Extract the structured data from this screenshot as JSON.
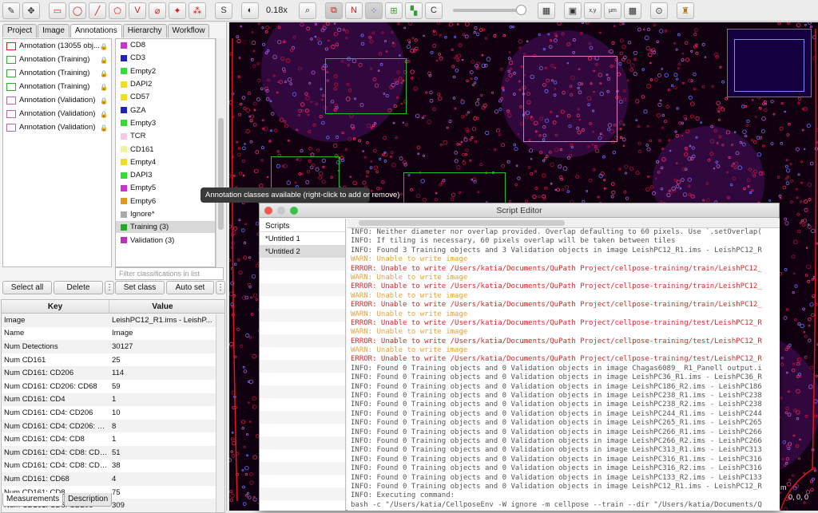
{
  "toolbar": {
    "buttons": [
      {
        "name": "brush-tool-icon",
        "glyph": "✎"
      },
      {
        "name": "move-tool-icon",
        "glyph": "✥"
      },
      {
        "name": "rectangle-tool-icon",
        "glyph": "▭",
        "color": "red"
      },
      {
        "name": "ellipse-tool-icon",
        "glyph": "◯",
        "color": "red"
      },
      {
        "name": "line-tool-icon",
        "glyph": "╱",
        "color": "red"
      },
      {
        "name": "polygon-tool-icon",
        "glyph": "⬠",
        "color": "red"
      },
      {
        "name": "polyline-tool-icon",
        "glyph": "V",
        "color": "red"
      },
      {
        "name": "brush-annotation-icon",
        "glyph": "⌀",
        "color": "red"
      },
      {
        "name": "wand-tool-icon",
        "glyph": "✦",
        "color": "red"
      },
      {
        "name": "points-tool-icon",
        "glyph": "⁂",
        "color": "red"
      }
    ],
    "selection_mode_label": "S",
    "zoom_label": "0.18x",
    "c_label": "C",
    "n_label": "N",
    "xy_label": "x,y",
    "um_label": "µm"
  },
  "left_tabs": [
    "Project",
    "Image",
    "Annotations",
    "Hierarchy",
    "Workflow"
  ],
  "active_left_tab": "Annotations",
  "annotations": [
    {
      "label": "Annotation (13055 obj...",
      "color": "#d02020"
    },
    {
      "label": "Annotation (Training)",
      "color": "#30b030"
    },
    {
      "label": "Annotation (Training)",
      "color": "#30b030"
    },
    {
      "label": "Annotation (Training)",
      "color": "#30b030"
    },
    {
      "label": "Annotation (Validation)",
      "color": "#c060b0"
    },
    {
      "label": "Annotation (Validation)",
      "color": "#c060b0"
    },
    {
      "label": "Annotation (Validation)",
      "color": "#c060b0"
    }
  ],
  "classes": [
    {
      "label": "CD8",
      "color": "#cc33cc"
    },
    {
      "label": "CD3",
      "color": "#1a22b8"
    },
    {
      "label": "Empty2",
      "color": "#33dd33"
    },
    {
      "label": "DAPI2",
      "color": "#eedd22"
    },
    {
      "label": "CD57",
      "color": "#eedd22"
    },
    {
      "label": "GZA",
      "color": "#1a22b8"
    },
    {
      "label": "Empty3",
      "color": "#33dd33"
    },
    {
      "label": "TCR",
      "color": "#f7c8e6"
    },
    {
      "label": "CD161",
      "color": "#eef5a0"
    },
    {
      "label": "Empty4",
      "color": "#eedd22"
    },
    {
      "label": "DAPI3",
      "color": "#33dd33"
    },
    {
      "label": "Empty5",
      "color": "#cc33cc"
    },
    {
      "label": "Empty6",
      "color": "#e09a1a"
    },
    {
      "label": "Ignore*",
      "color": "#aaaaaa"
    },
    {
      "label": "Training (3)",
      "color": "#22aa22",
      "selected": true
    },
    {
      "label": "Validation (3)",
      "color": "#bb33bb"
    }
  ],
  "filter_placeholder": "Filter classifications in list",
  "buttons": {
    "select_all": "Select all",
    "delete": "Delete",
    "more": "⋮",
    "set_class": "Set class",
    "auto_set": "Auto set"
  },
  "measure_table": {
    "headers": [
      "Key",
      "Value"
    ],
    "rows": [
      [
        "Image",
        "LeishPC12_R1.ims - LeishP..."
      ],
      [
        "Name",
        "Image"
      ],
      [
        "Num Detections",
        "30127"
      ],
      [
        "Num CD161",
        "25"
      ],
      [
        "Num CD161: CD206",
        "114"
      ],
      [
        "Num CD161: CD206: CD68",
        "59"
      ],
      [
        "Num CD161: CD4",
        "1"
      ],
      [
        "Num CD161: CD4: CD206",
        "10"
      ],
      [
        "Num CD161: CD4: CD206: C...",
        "8"
      ],
      [
        "Num CD161: CD4: CD8",
        "1"
      ],
      [
        "Num CD161: CD4: CD8: CD2...",
        "51"
      ],
      [
        "Num CD161: CD4: CD8: CD2...",
        "38"
      ],
      [
        "Num CD161: CD68",
        "4"
      ],
      [
        "Num CD161: CD8",
        "75"
      ],
      [
        "Num CD161: CD8: CD206",
        "309"
      ]
    ]
  },
  "bottom_tabs": [
    "Measurements",
    "Description"
  ],
  "tooltip": "Annotation classes available (right-click to add or remove)",
  "viewer": {
    "scale_label": "m",
    "coord_label": "0, 0, 0"
  },
  "editor": {
    "title": "Script Editor",
    "scripts_header": "Scripts",
    "scripts": [
      {
        "label": "*Untitled 1",
        "selected": false
      },
      {
        "label": "*Untitled 2",
        "selected": true
      }
    ],
    "lines": [
      {
        "t": "INFO: Neither diameter nor overlap provided. Overlap defaulting to 60 pixels. Use `.setOverlap(",
        "k": "info"
      },
      {
        "t": "INFO: If tiling is necessary, 60 pixels overlap will be taken between tiles",
        "k": "info"
      },
      {
        "t": "INFO: Found 3 Training objects and 3 Validation objects in image LeishPC12_R1.ims - LeishPC12_R",
        "k": "info"
      },
      {
        "t": "WARN: Unable to write image",
        "k": "warn"
      },
      {
        "t": "ERROR: Unable to write /Users/katia/Documents/QuPath Project/cellpose-training/train/LeishPC12_",
        "k": "err"
      },
      {
        "t": "WARN: Unable to write image",
        "k": "warn"
      },
      {
        "t": "ERROR: Unable to write /Users/katia/Documents/QuPath Project/cellpose-training/train/LeishPC12_",
        "k": "err"
      },
      {
        "t": "WARN: Unable to write image",
        "k": "warn"
      },
      {
        "t": "ERROR: Unable to write /Users/katia/Documents/QuPath Project/cellpose-training/train/LeishPC12_",
        "k": "err"
      },
      {
        "t": "WARN: Unable to write image",
        "k": "warn"
      },
      {
        "t": "ERROR: Unable to write /Users/katia/Documents/QuPath Project/cellpose-training/test/LeishPC12_R",
        "k": "err"
      },
      {
        "t": "WARN: Unable to write image",
        "k": "warn"
      },
      {
        "t": "ERROR: Unable to write /Users/katia/Documents/QuPath Project/cellpose-training/test/LeishPC12_R",
        "k": "err"
      },
      {
        "t": "WARN: Unable to write image",
        "k": "warn"
      },
      {
        "t": "ERROR: Unable to write /Users/katia/Documents/QuPath Project/cellpose-training/test/LeishPC12_R",
        "k": "err"
      },
      {
        "t": "INFO: Found 0 Training objects and 0 Validation objects in image Chagas6089_ R1_Panell output.i",
        "k": "info"
      },
      {
        "t": "INFO: Found 0 Training objects and 0 Validation objects in image LeishPC36_R1.ims - LeishPC36_R",
        "k": "info"
      },
      {
        "t": "INFO: Found 0 Training objects and 0 Validation objects in image LeishPC186_R2.ims - LeishPC186",
        "k": "info"
      },
      {
        "t": "INFO: Found 0 Training objects and 0 Validation objects in image LeishPC238_R1.ims - LeishPC238",
        "k": "info"
      },
      {
        "t": "INFO: Found 0 Training objects and 0 Validation objects in image LeishPC238_R2.ims - LeishPC238",
        "k": "info"
      },
      {
        "t": "INFO: Found 0 Training objects and 0 Validation objects in image LeishPC244_R1.ims - LeishPC244",
        "k": "info"
      },
      {
        "t": "INFO: Found 0 Training objects and 0 Validation objects in image LeishPC265_R1.ims - LeishPC265",
        "k": "info"
      },
      {
        "t": "INFO: Found 0 Training objects and 0 Validation objects in image LeishPC266_R1.ims - LeishPC266",
        "k": "info"
      },
      {
        "t": "INFO: Found 0 Training objects and 0 Validation objects in image LeishPC266_R2.ims - LeishPC266",
        "k": "info"
      },
      {
        "t": "INFO: Found 0 Training objects and 0 Validation objects in image LeishPC313_R1.ims - LeishPC313",
        "k": "info"
      },
      {
        "t": "INFO: Found 0 Training objects and 0 Validation objects in image LeishPC316_R1.ims - LeishPC316",
        "k": "info"
      },
      {
        "t": "INFO: Found 0 Training objects and 0 Validation objects in image LeishPC316_R2.ims - LeishPC316",
        "k": "info"
      },
      {
        "t": "INFO: Found 0 Training objects and 0 Validation objects in image LeishPC133_R2.ims - LeishPC133",
        "k": "info"
      },
      {
        "t": "INFO: Found 0 Training objects and 0 Validation objects in image LeishPC12_R1.ims - LeishPC12_R",
        "k": "info"
      },
      {
        "t": "INFO: Executing command:",
        "k": "info"
      },
      {
        "t": "bash -c \"/Users/katia/CellposeEnv -W ignore -m cellpose --train --dir \"/Users/katia/Documents/Q",
        "k": "info"
      }
    ]
  }
}
